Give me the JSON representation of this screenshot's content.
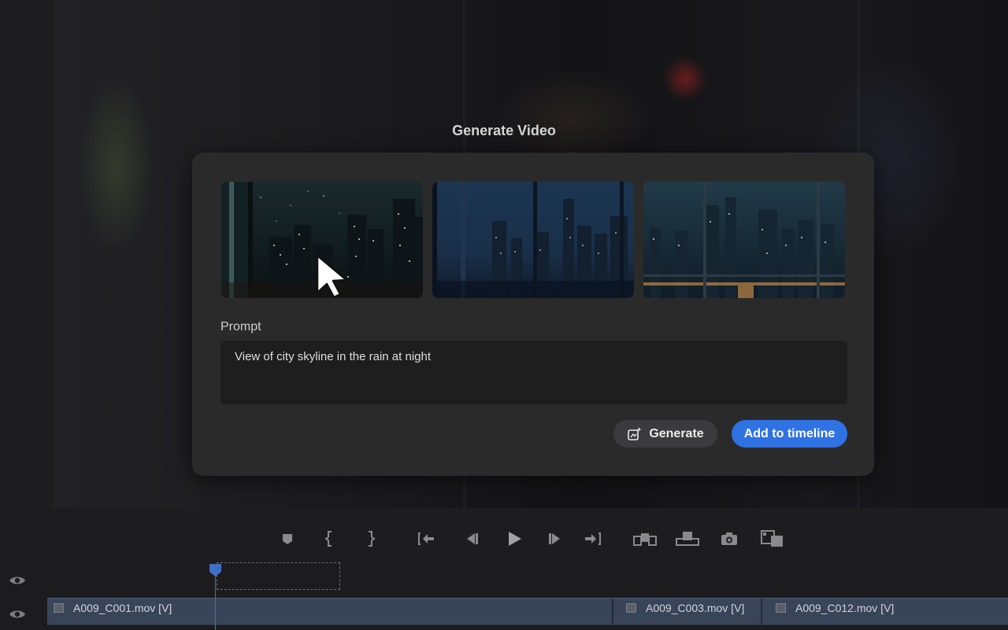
{
  "dialog": {
    "title": "Generate Video",
    "thumbnails": [
      {
        "name": "thumbnail-rainy-window-skyline",
        "selected": true
      },
      {
        "name": "thumbnail-window-skyline-dusk",
        "selected": false
      },
      {
        "name": "thumbnail-window-skyline-rain",
        "selected": false
      }
    ],
    "prompt_label": "Prompt",
    "prompt_value": "View of city skyline in the rain at night",
    "generate_label": "Generate",
    "add_label": "Add to timeline"
  },
  "transport": {
    "icons": [
      "marker-icon",
      "mark-in-icon",
      "mark-out-icon",
      "go-to-in-icon",
      "step-back-icon",
      "play-icon",
      "step-forward-icon",
      "go-to-out-icon",
      "insert-icon",
      "overwrite-icon",
      "export-frame-icon",
      "compare-icon"
    ]
  },
  "timeline": {
    "clips": [
      {
        "label": "A009_C001.mov [V]"
      },
      {
        "label": "A009_C003.mov [V]"
      },
      {
        "label": "A009_C012.mov [V]"
      }
    ]
  },
  "colors": {
    "accent": "#2f72e4",
    "dialog_bg": "#2a2a2b",
    "clip_bg": "#384458",
    "playhead": "#3e6fc7"
  }
}
